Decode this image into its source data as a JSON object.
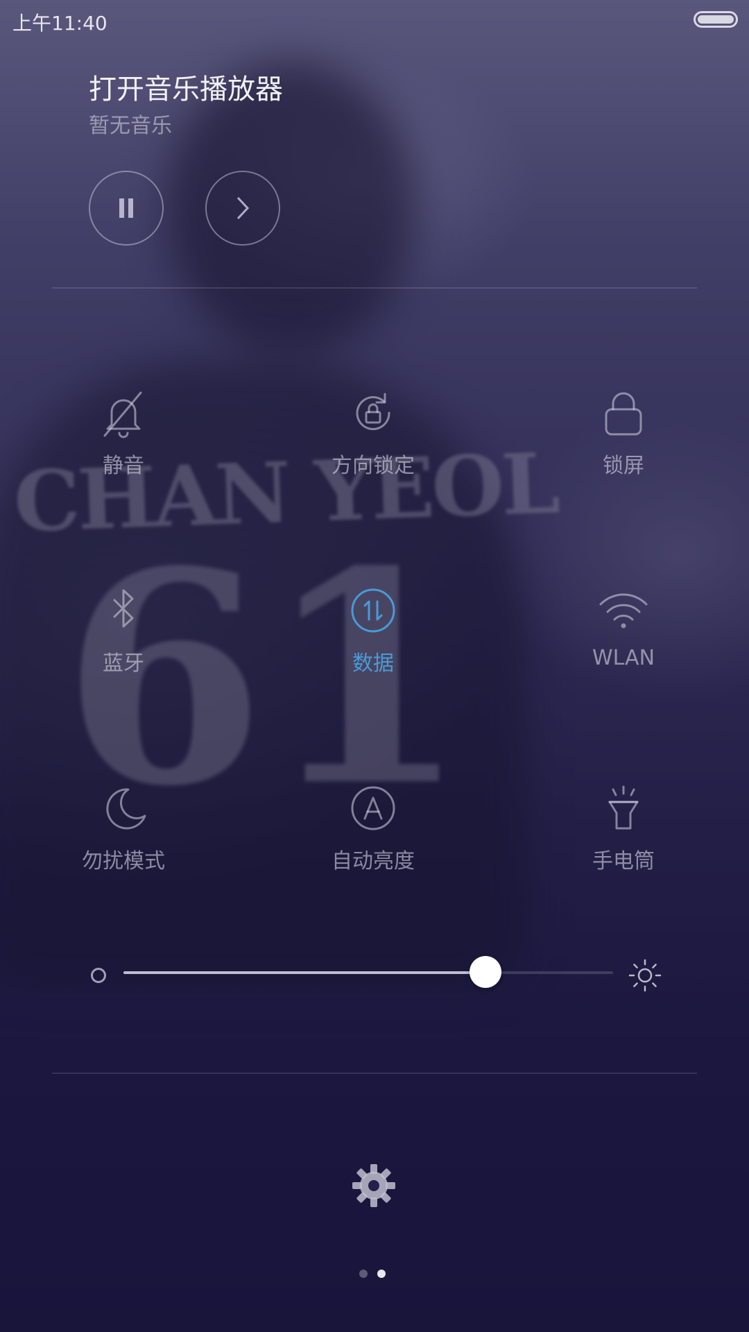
{
  "status_bar": {
    "time": "上午11:40",
    "battery_icon": "battery-icon"
  },
  "music": {
    "title": "打开音乐播放器",
    "subtitle": "暂无音乐",
    "pause_icon": "pause-icon",
    "next_icon": "next-icon"
  },
  "toggles": [
    {
      "label": "静音",
      "icon": "bell-off-icon",
      "active": false
    },
    {
      "label": "方向锁定",
      "icon": "rotation-lock-icon",
      "active": false
    },
    {
      "label": "锁屏",
      "icon": "lock-icon",
      "active": false
    },
    {
      "label": "蓝牙",
      "icon": "bluetooth-icon",
      "active": false
    },
    {
      "label": "数据",
      "icon": "mobile-data-icon",
      "active": true
    },
    {
      "label": "WLAN",
      "icon": "wifi-icon",
      "active": false
    },
    {
      "label": "勿扰模式",
      "icon": "moon-icon",
      "active": false
    },
    {
      "label": "自动亮度",
      "icon": "auto-brightness-icon",
      "active": false
    },
    {
      "label": "手电筒",
      "icon": "flashlight-icon",
      "active": false
    }
  ],
  "brightness": {
    "level": 0.74
  },
  "settings_icon": "gear-icon",
  "pager": {
    "count": 2,
    "active_index": 1
  },
  "colors": {
    "active": "#4a9ad6",
    "inactive": "#d7d7e4"
  }
}
